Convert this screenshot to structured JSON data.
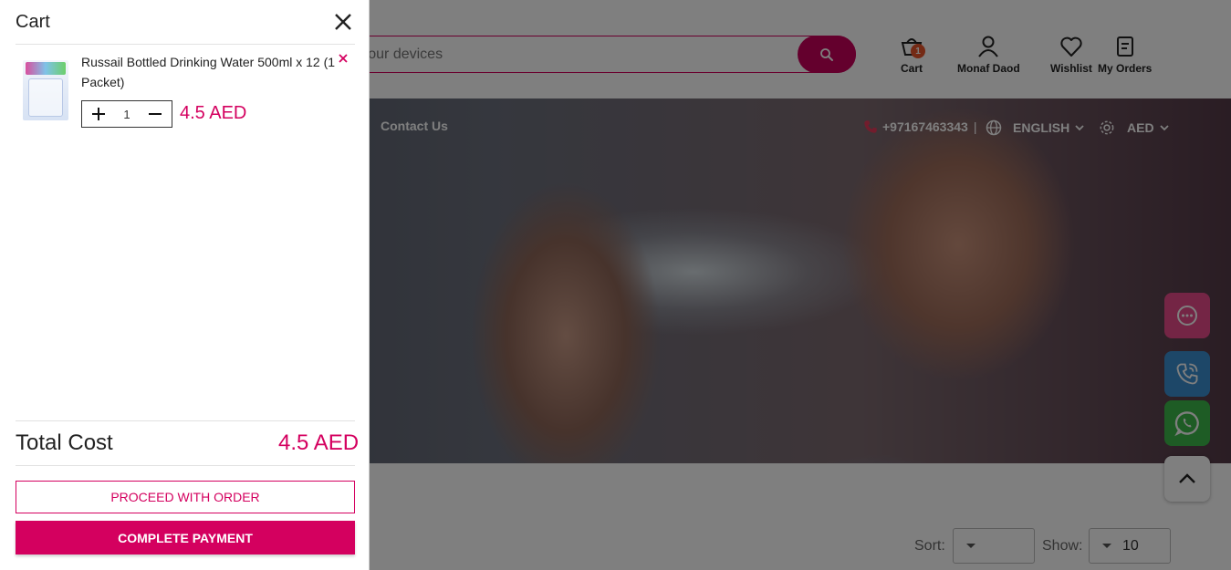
{
  "header": {
    "search": {
      "placeholder": "Search for your devices"
    },
    "cart": {
      "label": "Cart",
      "count": "1"
    },
    "account": {
      "label": "Monaf Daod"
    },
    "wishlist": {
      "label": "Wishlist"
    },
    "orders": {
      "label": "My Orders"
    }
  },
  "nav": {
    "contact": "Contact Us",
    "phone": "+97167463343",
    "phone_sep": "|",
    "language": "ENGLISH",
    "currency": "AED"
  },
  "listing": {
    "sort_label": "Sort:",
    "sort_value": "",
    "show_label": "Show:",
    "show_value": "10"
  },
  "cart": {
    "title": "Cart",
    "items": [
      {
        "name_line1": "Russail Bottled Drinking Water 500ml x 12 (1",
        "name_line2": "Packet)",
        "quantity": "1",
        "price": "4.5 AED"
      }
    ],
    "total_label": "Total Cost",
    "total_value": "4.5 AED",
    "proceed_label": "PROCEED WITH ORDER",
    "pay_label": "COMPLETE PAYMENT"
  },
  "colors": {
    "accent": "#d4005f",
    "chat": "#e84b8a",
    "call": "#3a8fd1",
    "whatsapp": "#3cb94a"
  },
  "icons": [
    "search-icon",
    "cart-icon",
    "user-icon",
    "heart-icon",
    "orders-icon",
    "phone-icon",
    "globe-icon",
    "gear-icon",
    "chevron-down-icon",
    "chat-icon",
    "call-icon",
    "whatsapp-icon",
    "chevron-up-icon",
    "close-icon",
    "plus-icon",
    "minus-icon"
  ]
}
